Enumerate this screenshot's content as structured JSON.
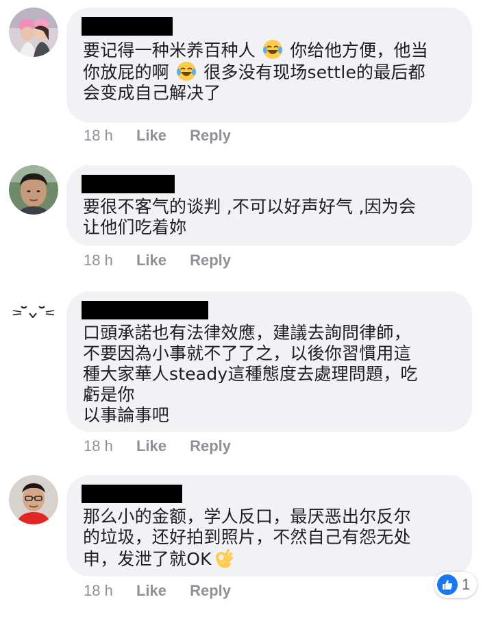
{
  "comments": [
    {
      "avatar": "avatar-couple-photo",
      "text_lines": [
        "要记得一种米养百种人 ",
        " 你给他方便，他当",
        "你放屁的啊 ",
        " 很多没有现场settle的最后都",
        "会变成自己解决了"
      ],
      "emojis": [
        "laughing-crying-emoji",
        "laughing-crying-emoji"
      ],
      "time": "18 h",
      "like": "Like",
      "reply": "Reply"
    },
    {
      "avatar": "avatar-man-photo",
      "text": "要很不客气的谈判 ,不可以好声好气 ,因为会\n让他们吃着妳",
      "time": "18 h",
      "like": "Like",
      "reply": "Reply"
    },
    {
      "avatar": "avatar-cat-face",
      "text": "口頭承諾也有法律效應，建議去詢問律師，\n不要因為小事就不了了之，以後你習慣用這\n種大家華人steady這種態度去處理問題，吃\n虧是你\n以事論事吧",
      "time": "18 h",
      "like": "Like",
      "reply": "Reply"
    },
    {
      "avatar": "avatar-man-glasses-photo",
      "text_lines": [
        "那么小的金额，学人反口，最厌恶出尔反尔",
        "的垃圾，还好拍到照片，不然自己有怨无处",
        "申，发泄了就OK"
      ],
      "emojis": [
        "ok-hand-emoji"
      ],
      "time": "18 h",
      "like": "Like",
      "reply": "Reply"
    }
  ],
  "reaction": {
    "icon": "thumbs-up-icon",
    "count": "1",
    "color": "#1877f2"
  },
  "colors": {
    "bubble": "#f1f2f5",
    "meta": "#8e9197",
    "text": "#1c1e21"
  }
}
